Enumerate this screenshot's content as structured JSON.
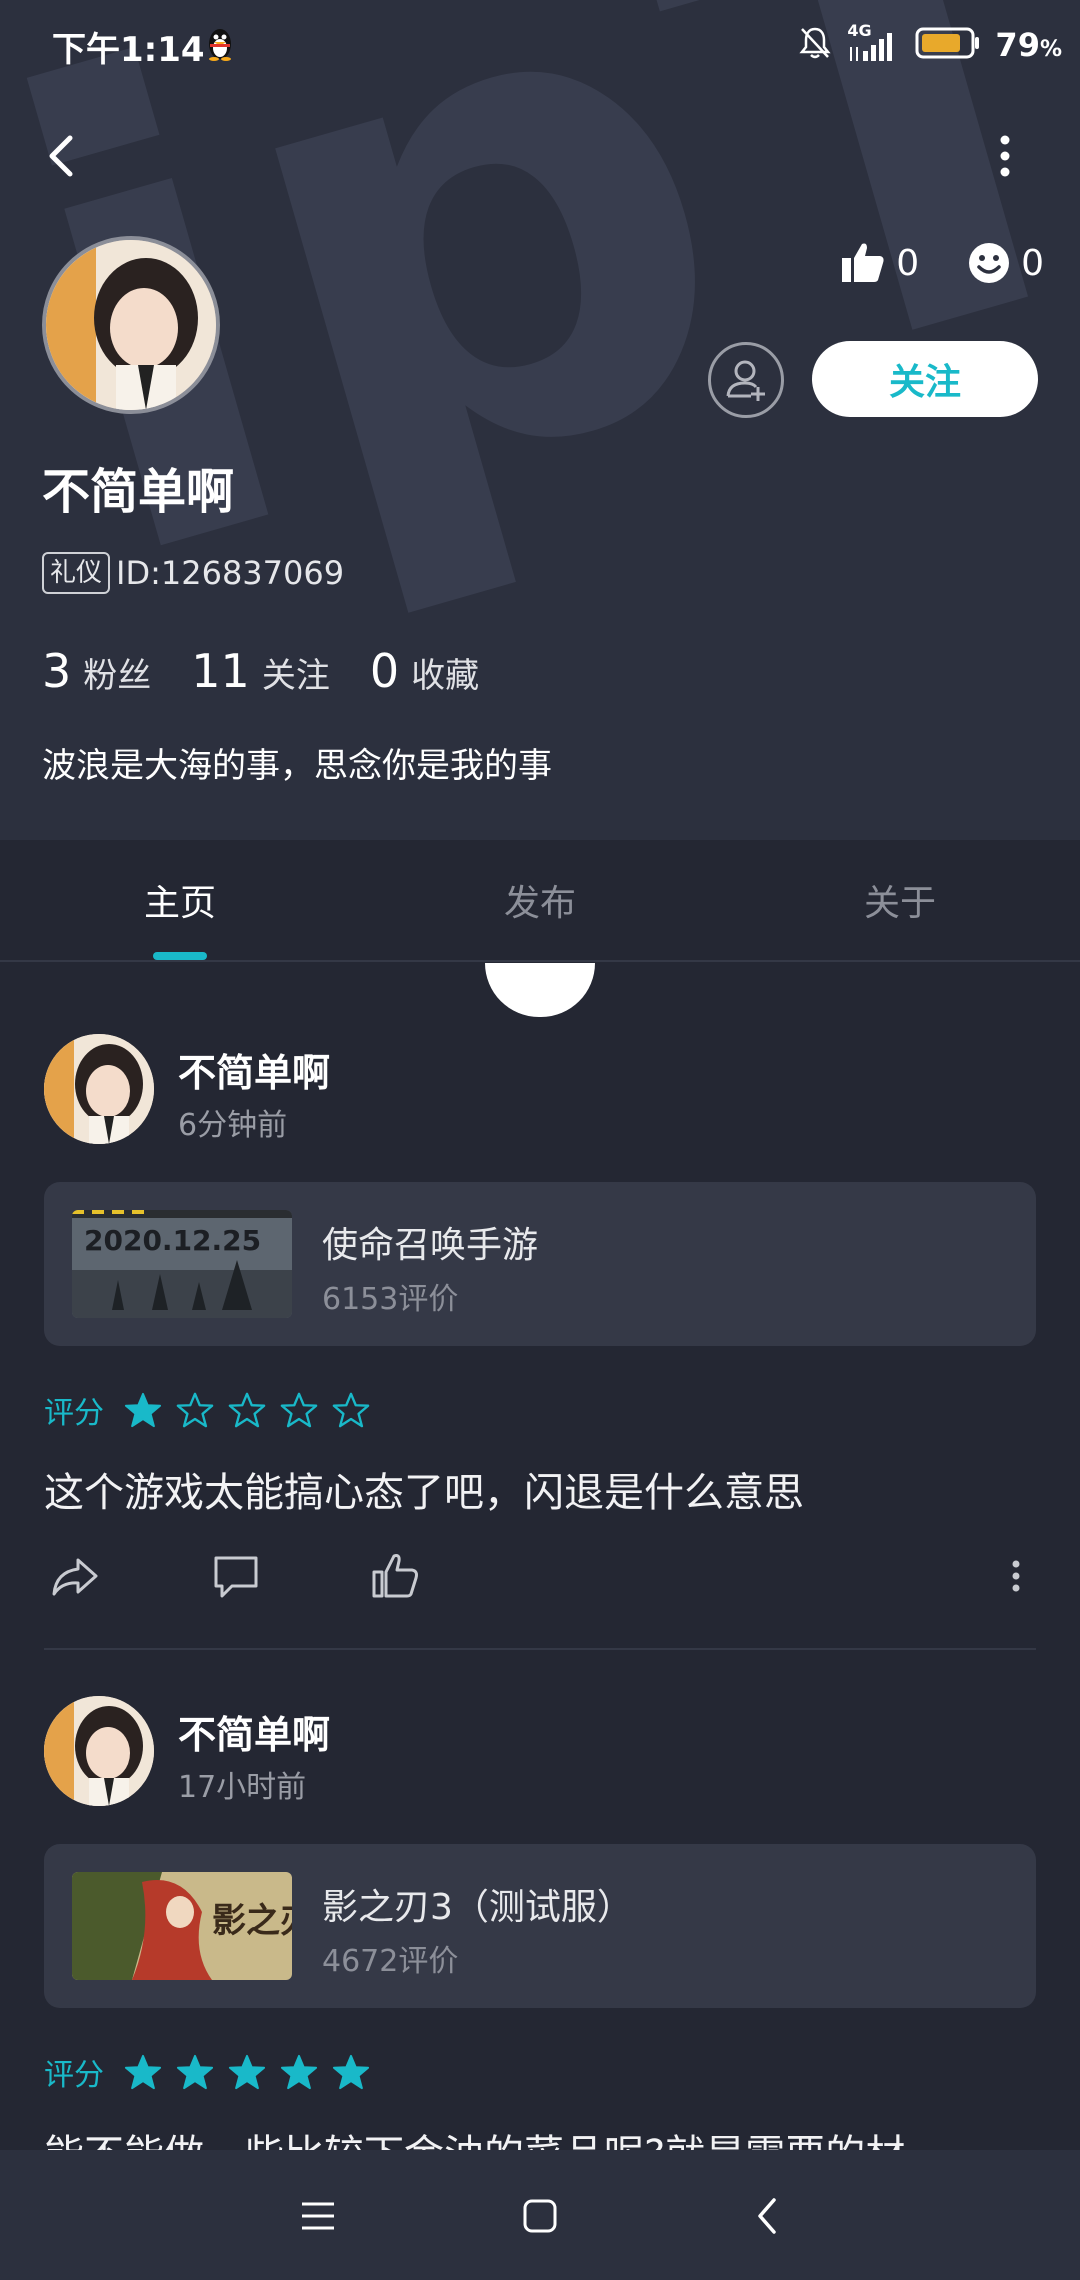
{
  "status_bar": {
    "time": "下午1:14",
    "network": "4G",
    "battery_pct": "79",
    "battery_unit": "%"
  },
  "profile": {
    "likes": "0",
    "smiles": "0",
    "follow_label": "关注",
    "name": "不简单啊",
    "badge": "礼仪",
    "id_text": "ID:126837069",
    "followers_count": "3",
    "followers_label": "粉丝",
    "following_count": "11",
    "following_label": "关注",
    "favorites_count": "0",
    "favorites_label": "收藏",
    "bio": "波浪是大海的事，思念你是我的事"
  },
  "tabs": [
    {
      "label": "主页",
      "active": true
    },
    {
      "label": "发布",
      "active": false
    },
    {
      "label": "关于",
      "active": false
    }
  ],
  "posts": [
    {
      "author": "不简单啊",
      "time": "6分钟前",
      "game_name": "使命召唤手游",
      "game_reviews": "6153评价",
      "thumb_text": "2020.12.25",
      "rating_label": "评分",
      "rating": 1,
      "text": "这个游戏太能搞心态了吧，闪退是什么意思"
    },
    {
      "author": "不简单啊",
      "time": "17小时前",
      "game_name": "影之刃3（测试服）",
      "game_reviews": "4672评价",
      "thumb_text": "影之刃",
      "rating_label": "评分",
      "rating": 5,
      "text": "能不能做一些比较下金油的菜品呢?就是需要的材"
    }
  ],
  "colors": {
    "accent": "#19b9c9",
    "header_bg": "#2c303e",
    "page_bg": "#242733",
    "card_bg": "#353947"
  }
}
